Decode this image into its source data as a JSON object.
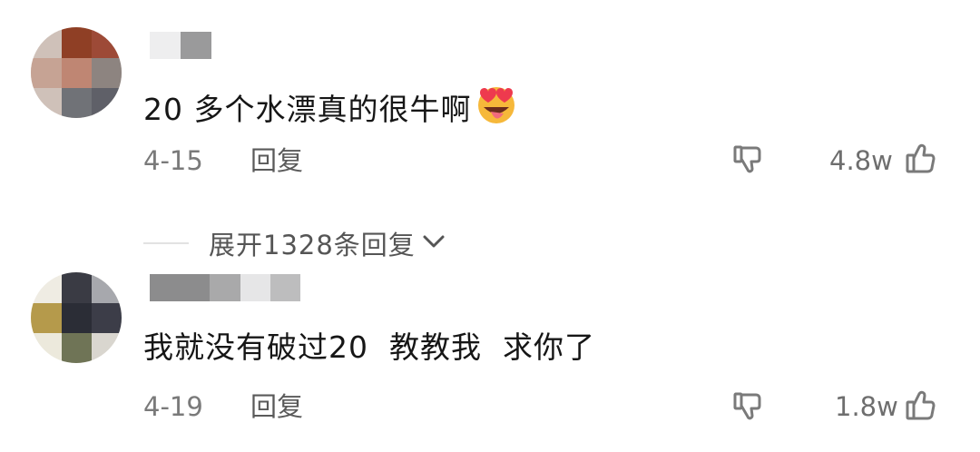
{
  "comments": [
    {
      "text": "20 多个水漂真的很牛啊",
      "emoji_icon": "heart-eyes-tongue-emoji",
      "date": "4-15",
      "reply_label": "回复",
      "like_count": "4.8w"
    },
    {
      "text": "我就没有破过20  教教我  求你了",
      "date": "4-19",
      "reply_label": "回复",
      "like_count": "1.8w"
    }
  ],
  "expand": {
    "label": "展开1328条回复"
  },
  "icons": {
    "dislike": "thumbs-down-icon",
    "like": "thumbs-up-icon",
    "chevron": "chevron-down-icon"
  },
  "colors": {
    "text": "#161616",
    "meta": "#7a7a7a"
  }
}
